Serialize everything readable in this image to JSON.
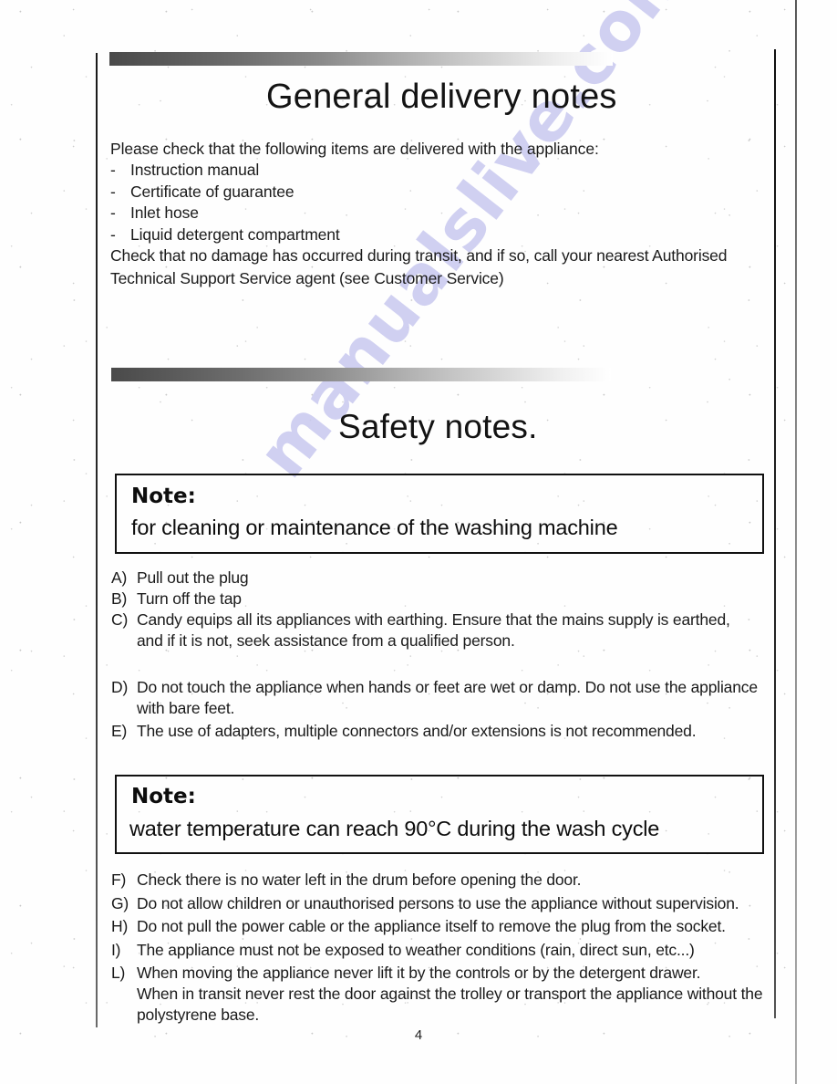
{
  "document": {
    "watermark": "manualslive.com",
    "page_number": "4",
    "accent_dark": "#4a4a4a",
    "text_color": "#1a1a1a"
  },
  "sections": {
    "delivery": {
      "title": "General delivery notes",
      "intro": "Please check that the following items are delivered with the appliance:",
      "dash": "-",
      "items": [
        "Instruction manual",
        "Certificate of guarantee",
        "Inlet hose",
        "Liquid detergent compartment"
      ],
      "closing": "Check that no damage has occurred during transit, and if so, call your nearest Authorised Technical Support Service agent (see Customer Service)"
    },
    "safety": {
      "title": "Safety notes.",
      "note_1": {
        "label": "Note:",
        "body": "for cleaning or maintenance of the washing machine"
      },
      "note_2": {
        "label": "Note:",
        "body": "water temperature can reach 90°C during the wash cycle"
      },
      "clauses_abc": [
        {
          "mark": "A)",
          "text": "Pull out the plug",
          "cont": ""
        },
        {
          "mark": "B)",
          "text": "Turn off the tap",
          "cont": ""
        },
        {
          "mark": "C)",
          "text": "Candy equips all its appliances with earthing. Ensure that the mains supply is earthed,",
          "cont": "and if it is not, seek assistance from a qualified person."
        }
      ],
      "clauses_de": [
        {
          "mark": "D)",
          "text": "Do not touch the appliance when hands or feet are wet or damp. Do not use the appliance",
          "cont": "with bare feet."
        },
        {
          "mark": "E)",
          "text": "The use of adapters, multiple connectors and/or extensions is not recommended.",
          "cont": ""
        }
      ],
      "clauses_fl": [
        {
          "mark": "F)",
          "text": "Check there is no water left in the drum before opening the door.",
          "cont": ""
        },
        {
          "mark": "G)",
          "text": "Do not allow children or unauthorised persons to use the appliance without supervision.",
          "cont": ""
        },
        {
          "mark": "H)",
          "text": "Do not pull the power cable or the appliance itself to remove the plug from the socket.",
          "cont": ""
        },
        {
          "mark": "I)",
          "text": "The appliance must not be exposed to weather conditions (rain, direct sun, etc...)",
          "cont": ""
        },
        {
          "mark": "L)",
          "text": "When moving the appliance never lift it by the controls or by the detergent drawer.",
          "cont": "When in transit never rest the door against the trolley or transport the appliance without the polystyrene base."
        }
      ]
    }
  }
}
